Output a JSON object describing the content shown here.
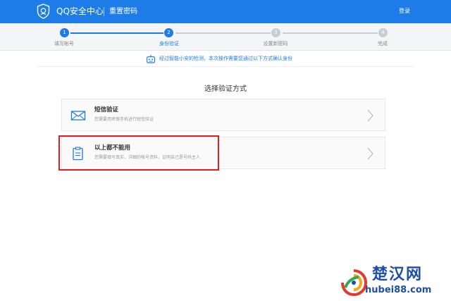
{
  "colors": {
    "header_bg": "#1d7ce8",
    "step_active": "#1d7ce8",
    "step_inactive": "#c9ced6",
    "highlight": "#e02020"
  },
  "header": {
    "brand": "QQ安全中心",
    "subtitle": "重置密码",
    "login": "登录",
    "logo_icon": "shield-icon"
  },
  "steps": [
    {
      "number": "1",
      "label": "填写帐号",
      "state": "done"
    },
    {
      "number": "2",
      "label": "身份验证",
      "state": "current"
    },
    {
      "number": "3",
      "label": "设置新密码",
      "state": "pending"
    },
    {
      "number": "4",
      "label": "完成",
      "state": "pending"
    }
  ],
  "notice": {
    "icon": "robot-icon",
    "text": "经过智能小安的检测，本次操作需要您通过以下方式确认身份"
  },
  "section_title": "选择验证方式",
  "options": [
    {
      "icon": "envelope-icon",
      "title": "短信验证",
      "desc": "您需要用密保手机进行短信验证",
      "highlighted": false
    },
    {
      "icon": "clipboard-icon",
      "title": "以上都不能用",
      "desc": "您需要填写真实、详细的帐号资料，证明自己是号码主人",
      "highlighted": true
    }
  ],
  "watermark": {
    "title": "楚汉网",
    "url": "hubei88.com"
  }
}
